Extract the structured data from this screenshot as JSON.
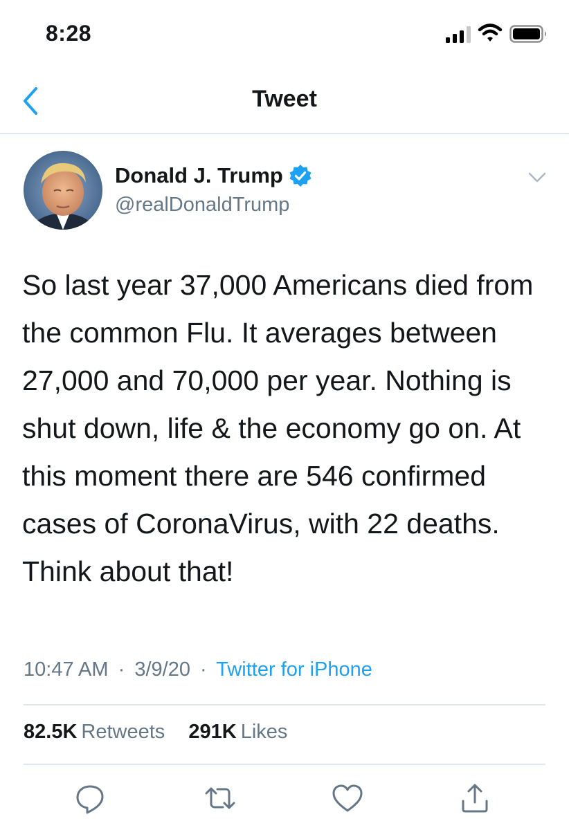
{
  "status_bar": {
    "time": "8:28"
  },
  "nav": {
    "title": "Tweet"
  },
  "author": {
    "display_name": "Donald J. Trump",
    "handle": "@realDonaldTrump",
    "verified": true
  },
  "tweet": {
    "text": "So last year 37,000 Americans died from the common Flu. It averages between 27,000 and 70,000 per year. Nothing is shut down, life & the economy go on. At this moment there are 546 confirmed cases of CoronaVirus, with 22 deaths. Think about that!",
    "time": "10:47 AM",
    "date": "3/9/20",
    "source": "Twitter for iPhone",
    "separator": "·"
  },
  "stats": {
    "retweets_count": "82.5K",
    "retweets_label": "Retweets",
    "likes_count": "291K",
    "likes_label": "Likes"
  },
  "icons": {
    "back": "chevron-left-icon",
    "caret": "chevron-down-icon",
    "verified": "verified-badge-icon",
    "reply": "reply-icon",
    "retweet": "retweet-icon",
    "like": "heart-icon",
    "share": "share-icon"
  },
  "colors": {
    "accent": "#1da1f2",
    "secondary_text": "#657786",
    "divider": "#e1e8ed",
    "text": "#14171a"
  }
}
